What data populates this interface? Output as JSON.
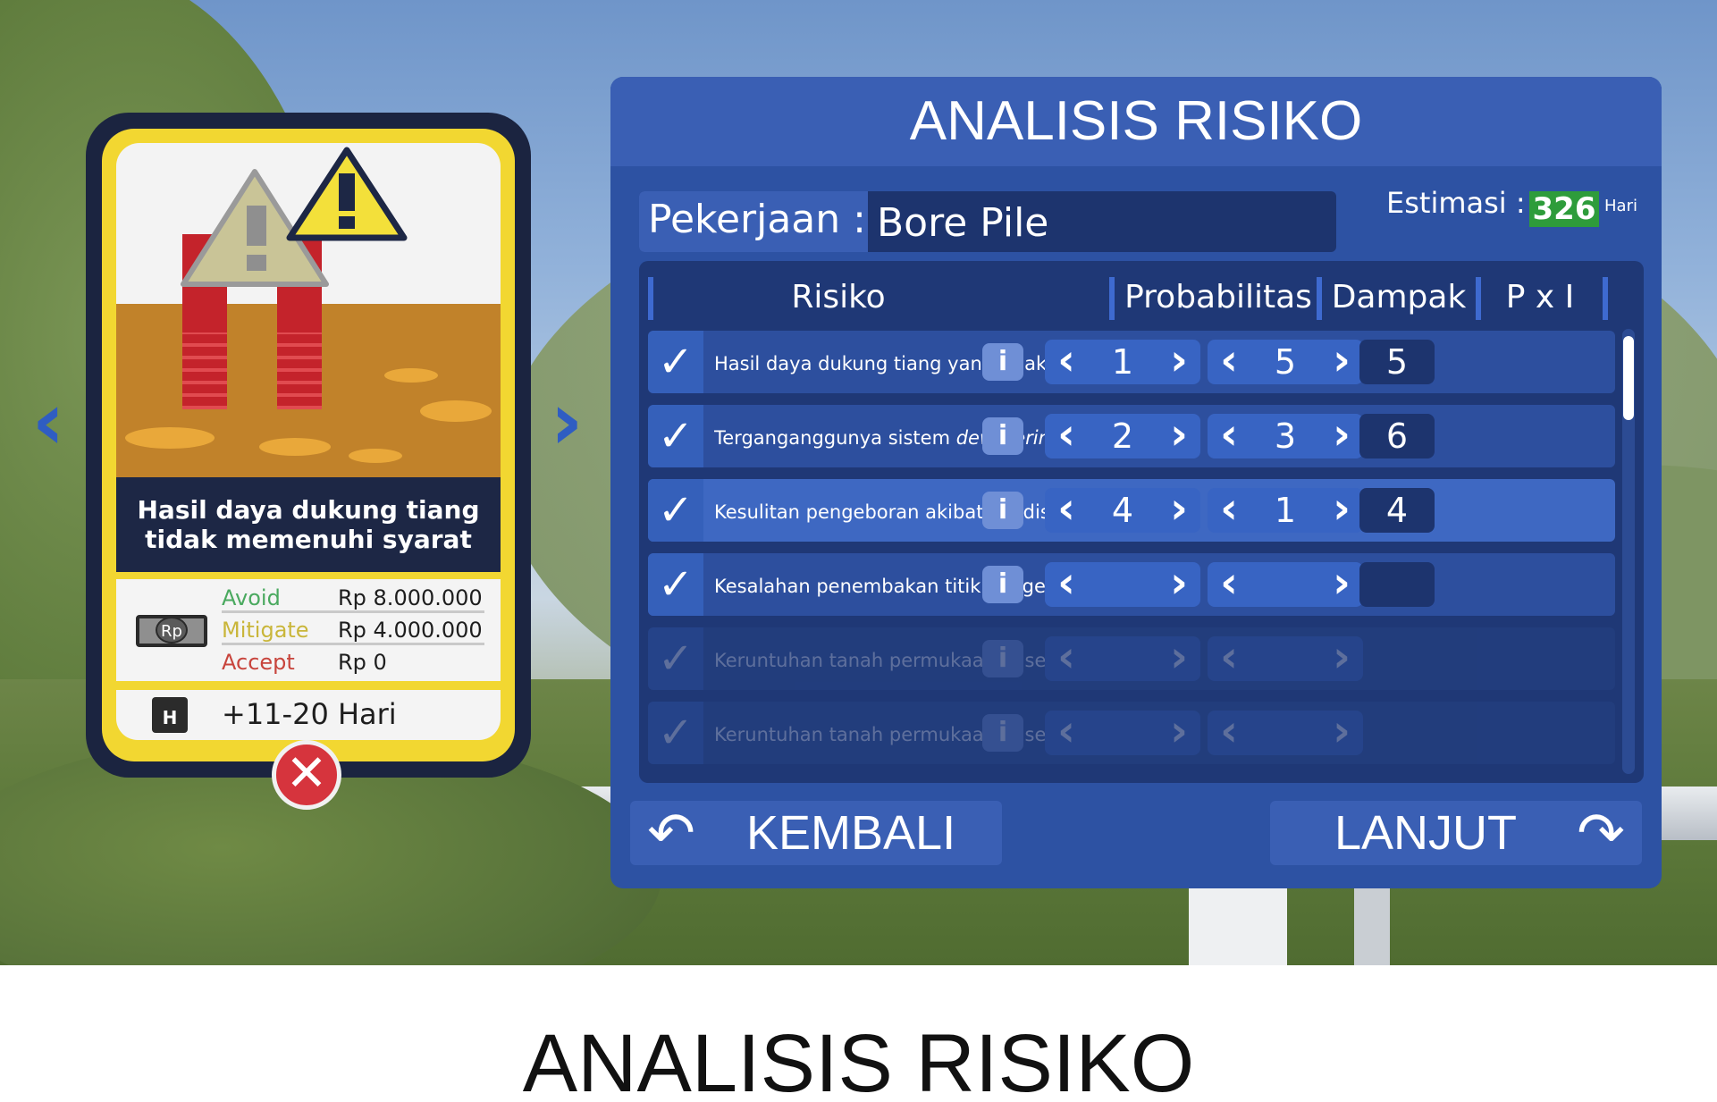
{
  "card": {
    "title": "Hasil daya dukung tiang\ntidak memenuhi syarat",
    "currency_icon_label": "Rp",
    "costs": [
      {
        "label": "Avoid",
        "value": "Rp 8.000.000",
        "color": "#4aa95f"
      },
      {
        "label": "Mitigate",
        "value": "Rp 4.000.000",
        "color": "#c9b63a"
      },
      {
        "label": "Accept",
        "value": "Rp 0",
        "color": "#c8443c"
      }
    ],
    "calendar_icon_label": "H",
    "time": "+11-20 Hari",
    "close_icon": "close-x-icon",
    "nav_left_icon": "chevron-left-icon",
    "nav_right_icon": "chevron-right-icon"
  },
  "panel": {
    "title": "ANALISIS RISIKO",
    "job_label": "Pekerjaan :",
    "job_value": "Bore Pile",
    "estimate_label": "Estimasi :",
    "estimate_value": "326",
    "estimate_unit": "Hari",
    "headers": {
      "risk": "Risiko",
      "probability": "Probabilitas",
      "impact": "Dampak",
      "pxi": "P x I"
    },
    "rows": [
      {
        "text": "Hasil daya dukung tiang yang tidak m",
        "probability": "1",
        "impact": "5",
        "pxi": "5",
        "state": "checked"
      },
      {
        "text": "Terganganggunya sistem dewatering",
        "probability": "2",
        "impact": "3",
        "pxi": "6",
        "state": "checked"
      },
      {
        "text": "Kesulitan pengeboran akibat kondisi t",
        "probability": "4",
        "impact": "1",
        "pxi": "4",
        "state": "selected"
      },
      {
        "text": "Kesalahan penembakan titik pengebo",
        "probability": "",
        "impact": "",
        "pxi": "",
        "state": "checked"
      },
      {
        "text": "Keruntuhan tanah permukaan di sekel",
        "probability": "",
        "impact": "",
        "pxi": "",
        "state": "disabled"
      },
      {
        "text": "Keruntuhan tanah permukaan di sekel",
        "probability": "",
        "impact": "",
        "pxi": "",
        "state": "disabled"
      }
    ],
    "back_label": "KEMBALI",
    "next_label": "LANJUT"
  },
  "caption": "ANALISIS RISIKO",
  "colors": {
    "panel": "#2d52a3",
    "card_frame": "#f2d731",
    "estimate": "#2e9c3b",
    "close": "#d6343d"
  }
}
